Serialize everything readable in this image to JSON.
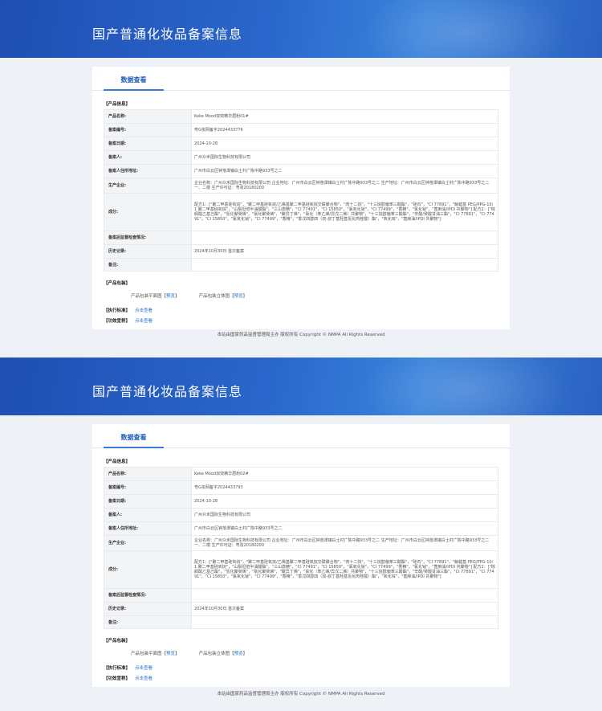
{
  "site_title": "国产普通化妆品备案信息",
  "tab_label": "数据查看",
  "section_product": "【产品信息】",
  "section_package": "【产品包装】",
  "labels": {
    "name": "产品名称:",
    "record_no": "备案编号:",
    "record_date": "备案日期:",
    "registrant": "备案人:",
    "address": "备案人住所地址:",
    "manufacturer": "生产企业:",
    "ingredients": "成分:",
    "supervision": "备案后监督检查情况:",
    "history": "历史记录:",
    "remark": "备注:"
  },
  "package": {
    "flat_label": "产品包装平面图",
    "solid_label": "产品包装立体图",
    "preview_open": "【",
    "preview_link": "预览",
    "preview_close": "】"
  },
  "standard_label": "【执行标准】",
  "efficacy_label": "【功效宣称】",
  "click_view": "点击查看",
  "footer": "本站由国家药品监督管理局主办 版权所有 Copyright © NMPA All Rights Reserved",
  "records": [
    {
      "name": "Keke Mood双效精华眉粉01#",
      "record_no": "粤G妆网备字2024433776",
      "record_date": "2024-10-28",
      "registrant": "广州众禾国际生物科技有限公司",
      "address": "广州市白云区钟落潭镇白土村广陈中路933号之二",
      "manufacturer": "企业名称：广州众禾国际生物科技有限公司 企业地址：广州市白云区钟落潭镇白土村广陈中路933号之二 生产地址：广州市白云区钟落潭镇白土村广陈中路933号之二一、二楼 生产许可证：粤妆20180200",
      "ingredients": "配方1：[\"聚二甲基硅氧烷\"，\"聚二甲基硅氧烷/乙烯基聚二甲基硅氧烷交联聚合物\"，\"肉十二烷\"，\"十三烷醇偏苯三酸酯\"，\"硅石\"，\"CI 77891\"，\"鲸蜡基 PEG/PPG-10/1 聚二甲基硅氧烷\"，\"山梨坦倍半油酸酯\"，\"三山嵛精\"，\"CI 77491\"，\"CI 15850\"，\"氯氧化铋\"，\"CI 77499\"，\"香精\"，\"氯化铋\"，\"蓖麻油/IPDI 共聚物\"] 配方2：[\"棕榈酸乙基己酯\"，\"氢化聚癸烯\"，\"氯化聚癸烯\"，\"聚异丁烯\"，\"氯化（苯乙烯/异戊二烯）共聚物\"，\"十三烷醇偏苯三酸酯\"，\"辛酸/癸酸甘油三酯\"，\"CI 77891\"，\"CI 77491\"，\"CI 15850\"，\"氯氧化铋\"，\"CI 77499\"，\"香精\"，\"季戊四醇四（双-叔丁基羟基氢化肉桂酸）酯\"，\"氧化锌\"，\"蓖麻油/IPDI 共聚物\"]",
      "supervision": "",
      "history": "2024年10月30日 首次备案",
      "remark": ""
    },
    {
      "name": "Keke Mood双效精华眉粉02#",
      "record_no": "粤G妆网备字2024433793",
      "record_date": "2024-10-28",
      "registrant": "广州众禾国际生物科技有限公司",
      "address": "广州市白云区钟落潭镇白土村广陈中路933号之二",
      "manufacturer": "企业名称：广州众禾国际生物科技有限公司 企业地址：广州市白云区钟落潭镇白土村广陈中路933号之二 生产地址：广州市白云区钟落潭镇白土村广陈中路933号之二一、二楼 生产许可证：粤妆20180200",
      "ingredients": "配方1：[\"聚二甲基硅氧烷\"，\"聚二甲基硅氧烷/乙烯基聚二甲基硅氧烷交联聚合物\"，\"肉十二烷\"，\"十三烷醇偏苯三酸酯\"，\"硅石\"，\"CI 77891\"，\"鲸蜡基 PEG/PPG-10/1 聚二甲基硅氧烷\"，\"山梨坦倍半油酸酯\"，\"三山嵛精\"，\"CI 77491\"，\"CI 15850\"，\"氯氧化铋\"，\"CI 77499\"，\"香精\"，\"氯化铋\"，\"蓖麻油/IPDI 共聚物\"] 配方2：[\"棕榈酸乙基己酯\"，\"氢化聚癸烯\"，\"氯化聚癸烯\"，\"聚异丁烯\"，\"氯化（苯乙烯/异戊二烯）共聚物\"，\"十三烷醇偏苯三酸酯\"，\"辛酸/癸酸甘油三酯\"，\"CI 77891\"，\"CI 77491\"，\"CI 15850\"，\"氯氧化铋\"，\"CI 77499\"，\"香精\"，\"季戊四醇四（双-叔丁基羟基氢化肉桂酸）酯\"，\"氧化锌\"，\"蓖麻油/IPDI 共聚物\"]",
      "supervision": "",
      "history": "2024年10月30日 首次备案",
      "remark": ""
    }
  ]
}
